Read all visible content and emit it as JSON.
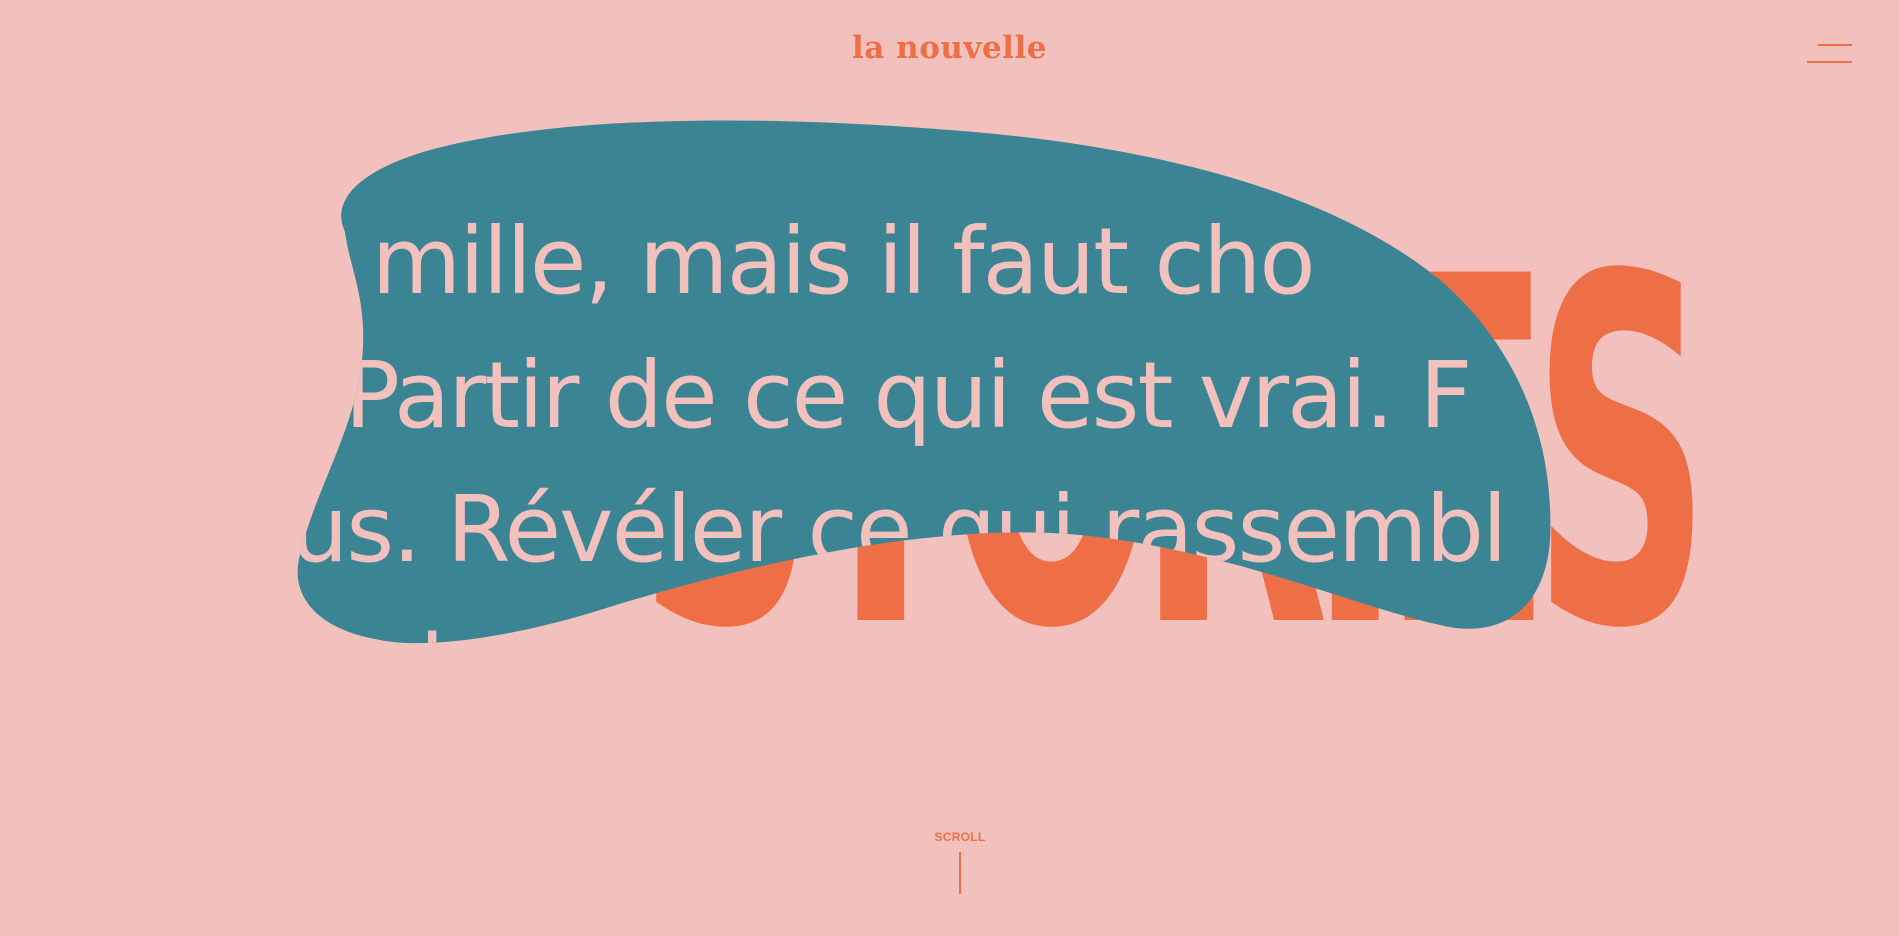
{
  "header": {
    "logo_text": "la nouvelle",
    "menu_icon": "hamburger-menu-icon"
  },
  "hero": {
    "background_word": "STORIES",
    "quote_lines": [
      "a mille, mais il faut cho",
      ". Partir de ce qui est vrai. F",
      "us. Révéler ce qui rassembl",
      "us to"
    ]
  },
  "scroll": {
    "label": "SCROLL"
  },
  "colors": {
    "background": "#f2c0bd",
    "accent": "#ee6f46",
    "blob": "#3b8494"
  }
}
